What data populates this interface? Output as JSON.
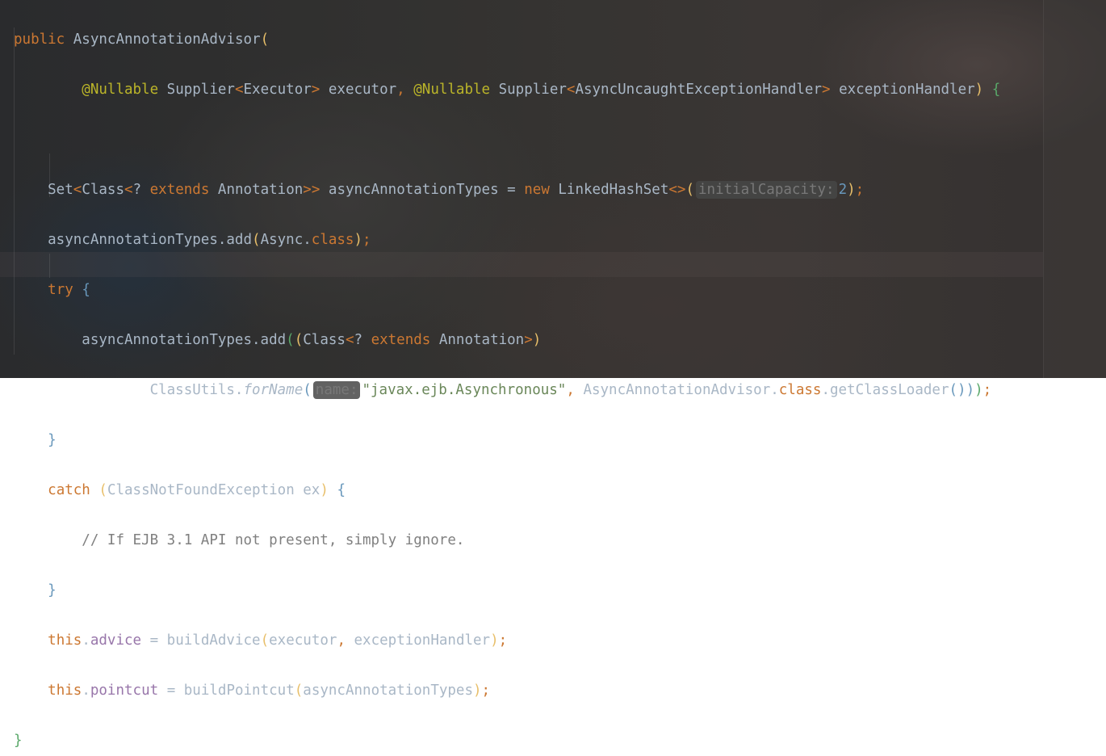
{
  "editor": {
    "lines": [
      "public AsyncAnnotationAdvisor(",
      "@Nullable Supplier<Executor> executor, @Nullable Supplier<AsyncUncaughtExceptionHandler> exceptionHandler) {",
      "",
      "Set<Class<? extends Annotation>> asyncAnnotationTypes = new LinkedHashSet<>(initialCapacity: 2);",
      "asyncAnnotationTypes.add(Async.class);",
      "try {",
      "asyncAnnotationTypes.add((Class<? extends Annotation>)",
      "ClassUtils.forName(name: \"javax.ejb.Asynchronous\", AsyncAnnotationAdvisor.class.getClassLoader()));",
      "}",
      "catch (ClassNotFoundException ex) {",
      "// If EJB 3.1 API not present, simply ignore.",
      "}",
      "this.advice = buildAdvice(executor, exceptionHandler);",
      "this.pointcut = buildPointcut(asyncAnnotationTypes);",
      "}"
    ],
    "hints": {
      "initial_capacity": "initialCapacity:",
      "name": "name:"
    },
    "colors": {
      "keyword": "#cc7832",
      "annotation": "#bbb529",
      "string": "#6a8759",
      "comment": "#808080",
      "field": "#9876aa",
      "number": "#6897bb",
      "text": "#a9b7c6"
    }
  }
}
